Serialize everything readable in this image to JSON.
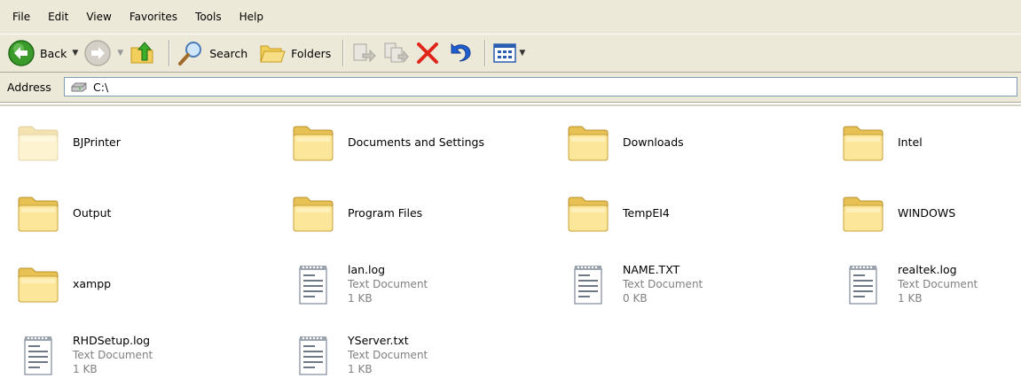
{
  "menu": [
    "File",
    "Edit",
    "View",
    "Favorites",
    "Tools",
    "Help"
  ],
  "toolbar": {
    "back_label": "Back",
    "search_label": "Search",
    "folders_label": "Folders"
  },
  "address": {
    "label": "Address",
    "path": "C:\\"
  },
  "items": [
    {
      "name": "BJPrinter",
      "kind": "folder",
      "faded": true
    },
    {
      "name": "Documents and Settings",
      "kind": "folder"
    },
    {
      "name": "Downloads",
      "kind": "folder"
    },
    {
      "name": "Intel",
      "kind": "folder"
    },
    {
      "name": "Output",
      "kind": "folder"
    },
    {
      "name": "Program Files",
      "kind": "folder"
    },
    {
      "name": "TempEI4",
      "kind": "folder"
    },
    {
      "name": "WINDOWS",
      "kind": "folder"
    },
    {
      "name": "xampp",
      "kind": "folder"
    },
    {
      "name": "lan.log",
      "kind": "file",
      "type": "Text Document",
      "size": "1 KB"
    },
    {
      "name": "NAME.TXT",
      "kind": "file",
      "type": "Text Document",
      "size": "0 KB"
    },
    {
      "name": "realtek.log",
      "kind": "file",
      "type": "Text Document",
      "size": "1 KB"
    },
    {
      "name": "RHDSetup.log",
      "kind": "file",
      "type": "Text Document",
      "size": "1 KB"
    },
    {
      "name": "YServer.txt",
      "kind": "file",
      "type": "Text Document",
      "size": "1 KB"
    }
  ]
}
